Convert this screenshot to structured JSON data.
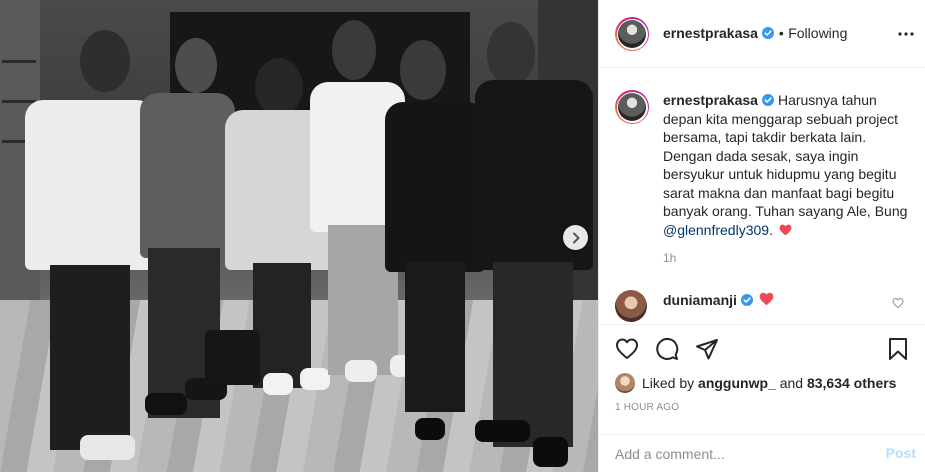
{
  "header": {
    "username": "ernestprakasa",
    "separator": "•",
    "follow_state": "Following",
    "more_icon": "more-horizontal-icon"
  },
  "caption": {
    "username": "ernestprakasa",
    "text": "Harusnya tahun depan kita menggarap sebuah project bersama, tapi takdir berkata lain. Dengan dada sesak, saya ingin bersyukur untuk hidupmu yang begitu sarat makna dan manfaat bagi begitu banyak orang. Tuhan sayang Ale, Bung",
    "mention": "@glennfredly309",
    "after_mention": ".",
    "relative_time": "1h"
  },
  "comment": {
    "username": "duniamanji"
  },
  "likes": {
    "prefix": "Liked by",
    "user": "anggunwp_",
    "conjunction": "and",
    "others": "83,634 others"
  },
  "post_time": "1 HOUR AGO",
  "add_comment": {
    "placeholder": "Add a comment...",
    "post_label": "Post"
  },
  "colors": {
    "verified": "#3897f0",
    "heart": "#ed4956",
    "link": "#00376b",
    "post_disabled": "#b2dffc",
    "muted": "#8e8e8e"
  },
  "icons": [
    "heart-icon",
    "comment-icon",
    "share-icon",
    "bookmark-icon",
    "chevron-right-icon",
    "verified-badge-icon"
  ]
}
